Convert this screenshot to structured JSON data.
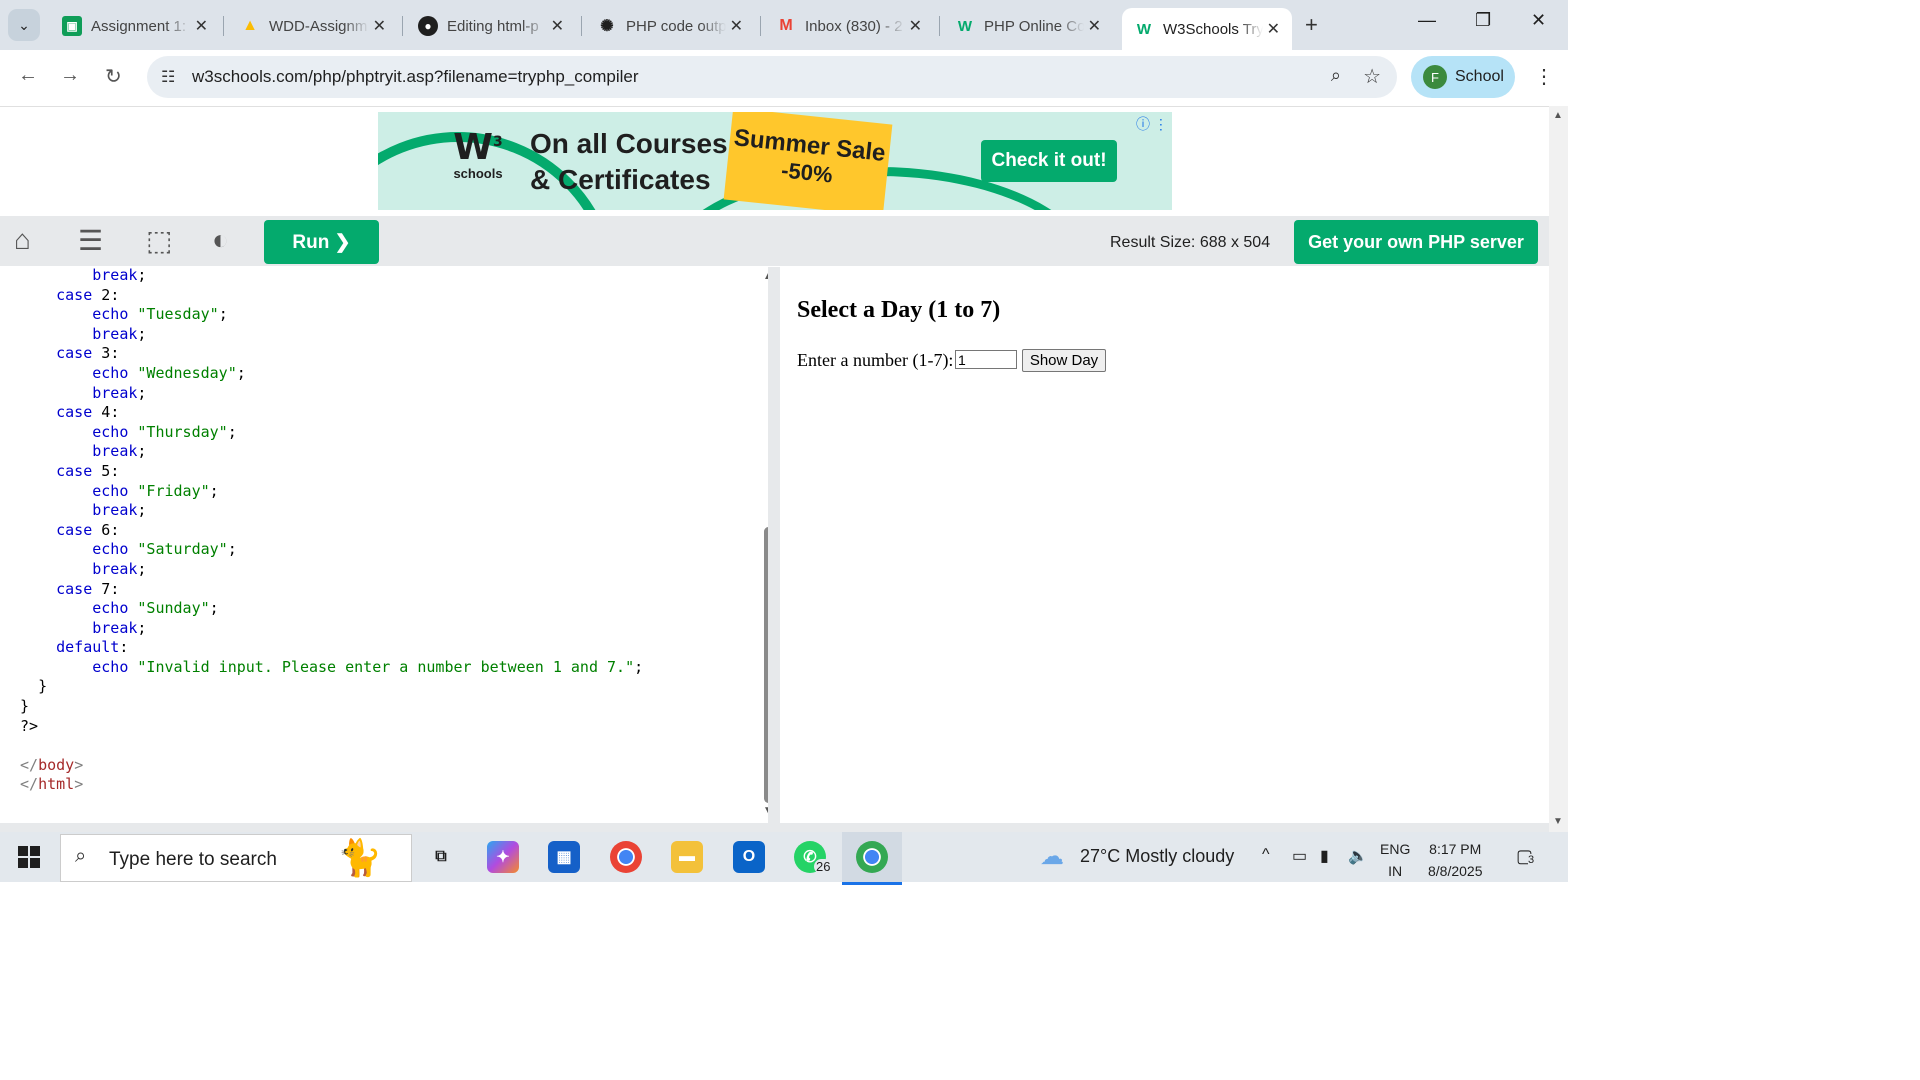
{
  "browser": {
    "tabs": [
      {
        "title": "Assignment 1:",
        "icon": "classroom-icon"
      },
      {
        "title": "WDD-Assignm",
        "icon": "drive-icon"
      },
      {
        "title": "Editing html-p",
        "icon": "github-icon"
      },
      {
        "title": "PHP code outp",
        "icon": "chatgpt-icon"
      },
      {
        "title": "Inbox (830) - 2",
        "icon": "gmail-icon"
      },
      {
        "title": "PHP Online Co",
        "icon": "w3schools-icon"
      },
      {
        "title": "W3Schools Try",
        "icon": "w3schools-icon",
        "active": true
      }
    ],
    "url": "w3schools.com/php/phptryit.asp?filename=tryphp_compiler",
    "profile": {
      "initial": "F",
      "name": "School"
    }
  },
  "ad": {
    "logo_mark": "W",
    "logo_super": "3",
    "logo_text": "schools",
    "line1": "On all Courses",
    "line2": "& Certificates",
    "sale_line1": "Summer Sale",
    "sale_line2": "-50%",
    "cta": "Check it out!"
  },
  "w3bar": {
    "run_label": "Run ❯",
    "result_size": "Result Size: 688 x 504",
    "server_label": "Get your own PHP server"
  },
  "code_lines": [
    {
      "indent": "        ",
      "tokens": [
        {
          "t": "break",
          "c": "kw"
        },
        {
          "t": ";",
          "c": "plain"
        }
      ]
    },
    {
      "indent": "    ",
      "tokens": [
        {
          "t": "case ",
          "c": "kw"
        },
        {
          "t": "2",
          "c": "plain"
        },
        {
          "t": ":",
          "c": "plain"
        }
      ]
    },
    {
      "indent": "        ",
      "tokens": [
        {
          "t": "echo ",
          "c": "kw"
        },
        {
          "t": "\"Tuesday\"",
          "c": "str"
        },
        {
          "t": ";",
          "c": "plain"
        }
      ]
    },
    {
      "indent": "        ",
      "tokens": [
        {
          "t": "break",
          "c": "kw"
        },
        {
          "t": ";",
          "c": "plain"
        }
      ]
    },
    {
      "indent": "    ",
      "tokens": [
        {
          "t": "case ",
          "c": "kw"
        },
        {
          "t": "3",
          "c": "plain"
        },
        {
          "t": ":",
          "c": "plain"
        }
      ]
    },
    {
      "indent": "        ",
      "tokens": [
        {
          "t": "echo ",
          "c": "kw"
        },
        {
          "t": "\"Wednesday\"",
          "c": "str"
        },
        {
          "t": ";",
          "c": "plain"
        }
      ]
    },
    {
      "indent": "        ",
      "tokens": [
        {
          "t": "break",
          "c": "kw"
        },
        {
          "t": ";",
          "c": "plain"
        }
      ]
    },
    {
      "indent": "    ",
      "tokens": [
        {
          "t": "case ",
          "c": "kw"
        },
        {
          "t": "4",
          "c": "plain"
        },
        {
          "t": ":",
          "c": "plain"
        }
      ]
    },
    {
      "indent": "        ",
      "tokens": [
        {
          "t": "echo ",
          "c": "kw"
        },
        {
          "t": "\"Thursday\"",
          "c": "str"
        },
        {
          "t": ";",
          "c": "plain"
        }
      ]
    },
    {
      "indent": "        ",
      "tokens": [
        {
          "t": "break",
          "c": "kw"
        },
        {
          "t": ";",
          "c": "plain"
        }
      ]
    },
    {
      "indent": "    ",
      "tokens": [
        {
          "t": "case ",
          "c": "kw"
        },
        {
          "t": "5",
          "c": "plain"
        },
        {
          "t": ":",
          "c": "plain"
        }
      ]
    },
    {
      "indent": "        ",
      "tokens": [
        {
          "t": "echo ",
          "c": "kw"
        },
        {
          "t": "\"Friday\"",
          "c": "str"
        },
        {
          "t": ";",
          "c": "plain"
        }
      ]
    },
    {
      "indent": "        ",
      "tokens": [
        {
          "t": "break",
          "c": "kw"
        },
        {
          "t": ";",
          "c": "plain"
        }
      ]
    },
    {
      "indent": "    ",
      "tokens": [
        {
          "t": "case ",
          "c": "kw"
        },
        {
          "t": "6",
          "c": "plain"
        },
        {
          "t": ":",
          "c": "plain"
        }
      ]
    },
    {
      "indent": "        ",
      "tokens": [
        {
          "t": "echo ",
          "c": "kw"
        },
        {
          "t": "\"Saturday\"",
          "c": "str"
        },
        {
          "t": ";",
          "c": "plain"
        }
      ]
    },
    {
      "indent": "        ",
      "tokens": [
        {
          "t": "break",
          "c": "kw"
        },
        {
          "t": ";",
          "c": "plain"
        }
      ]
    },
    {
      "indent": "    ",
      "tokens": [
        {
          "t": "case ",
          "c": "kw"
        },
        {
          "t": "7",
          "c": "plain"
        },
        {
          "t": ":",
          "c": "plain"
        }
      ]
    },
    {
      "indent": "        ",
      "tokens": [
        {
          "t": "echo ",
          "c": "kw"
        },
        {
          "t": "\"Sunday\"",
          "c": "str"
        },
        {
          "t": ";",
          "c": "plain"
        }
      ]
    },
    {
      "indent": "        ",
      "tokens": [
        {
          "t": "break",
          "c": "kw"
        },
        {
          "t": ";",
          "c": "plain"
        }
      ]
    },
    {
      "indent": "    ",
      "tokens": [
        {
          "t": "default",
          "c": "kw"
        },
        {
          "t": ":",
          "c": "plain"
        }
      ]
    },
    {
      "indent": "        ",
      "tokens": [
        {
          "t": "echo ",
          "c": "kw"
        },
        {
          "t": "\"Invalid input. Please enter a number between 1 and 7.\"",
          "c": "str"
        },
        {
          "t": ";",
          "c": "plain"
        }
      ]
    },
    {
      "indent": "  ",
      "tokens": [
        {
          "t": "}",
          "c": "plain"
        }
      ]
    },
    {
      "indent": "",
      "tokens": [
        {
          "t": "}",
          "c": "plain"
        }
      ]
    },
    {
      "indent": "",
      "tokens": [
        {
          "t": "?>",
          "c": "plain"
        }
      ]
    },
    {
      "indent": "",
      "tokens": []
    },
    {
      "indent": "",
      "tokens": [
        {
          "t": "</",
          "c": "br"
        },
        {
          "t": "body",
          "c": "tag"
        },
        {
          "t": ">",
          "c": "br"
        }
      ]
    },
    {
      "indent": "",
      "tokens": [
        {
          "t": "</",
          "c": "br"
        },
        {
          "t": "html",
          "c": "tag"
        },
        {
          "t": ">",
          "c": "br"
        }
      ]
    }
  ],
  "result": {
    "heading": "Select a Day (1 to 7)",
    "label": "Enter a number (1-7):",
    "input_value": "1",
    "button_label": "Show Day"
  },
  "taskbar": {
    "search_placeholder": "Type here to search",
    "whatsapp_badge": "26",
    "weather": "27°C  Mostly cloudy",
    "lang_line1": "ENG",
    "lang_line2": "IN",
    "time": "8:17 PM",
    "date": "8/8/2025",
    "notifications": "3"
  }
}
